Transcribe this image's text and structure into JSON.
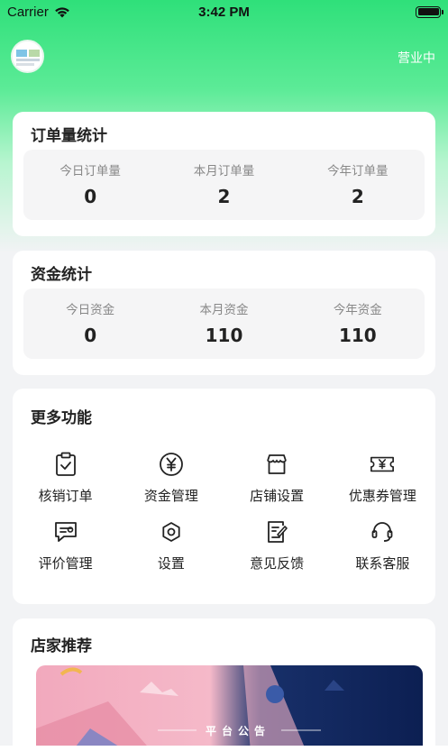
{
  "status_bar": {
    "carrier": "Carrier",
    "time": "3:42 PM"
  },
  "header": {
    "business_status": "营业中"
  },
  "order_stats": {
    "title": "订单量统计",
    "items": [
      {
        "label": "今日订单量",
        "value": "0"
      },
      {
        "label": "本月订单量",
        "value": "2"
      },
      {
        "label": "今年订单量",
        "value": "2"
      }
    ]
  },
  "fund_stats": {
    "title": "资金统计",
    "items": [
      {
        "label": "今日资金",
        "value": "0"
      },
      {
        "label": "本月资金",
        "value": "110"
      },
      {
        "label": "今年资金",
        "value": "110"
      }
    ]
  },
  "more_functions": {
    "title": "更多功能",
    "items": [
      {
        "label": "核销订单",
        "icon": "clipboard-check-icon"
      },
      {
        "label": "资金管理",
        "icon": "yen-circle-icon"
      },
      {
        "label": "店铺设置",
        "icon": "store-icon"
      },
      {
        "label": "优惠券管理",
        "icon": "coupon-icon"
      },
      {
        "label": "评价管理",
        "icon": "review-icon"
      },
      {
        "label": "设置",
        "icon": "settings-icon"
      },
      {
        "label": "意见反馈",
        "icon": "feedback-icon"
      },
      {
        "label": "联系客服",
        "icon": "headset-icon"
      }
    ]
  },
  "recommend": {
    "title": "店家推荐",
    "banner_text": "平台公告"
  },
  "colors": {
    "accent": "#2fe07a",
    "text": "#222222",
    "muted": "#888888"
  }
}
